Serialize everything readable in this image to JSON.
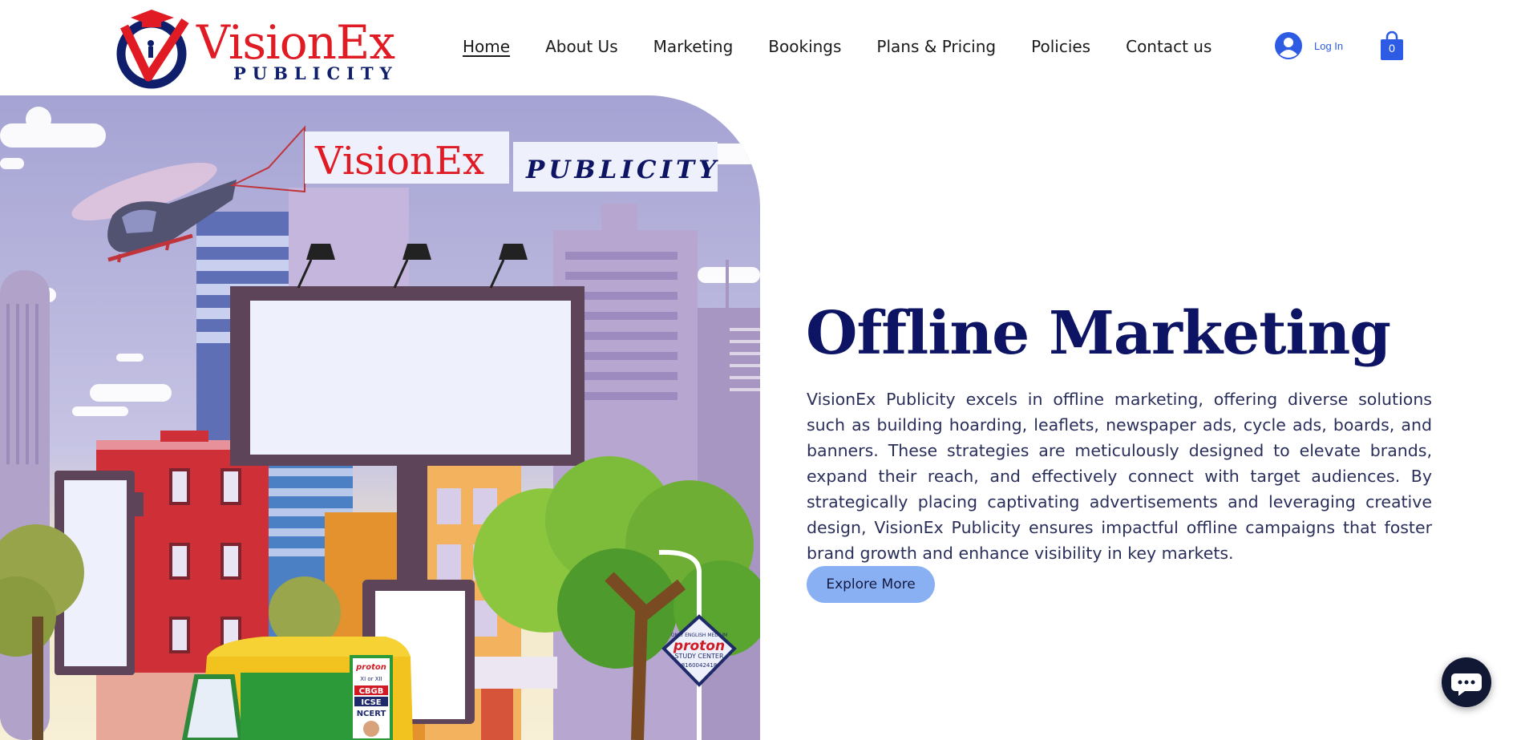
{
  "logo": {
    "word": "VisionEx",
    "sub": "PUBLICITY"
  },
  "nav": {
    "items": [
      {
        "label": "Home",
        "active": true
      },
      {
        "label": "About Us"
      },
      {
        "label": "Marketing"
      },
      {
        "label": "Bookings"
      },
      {
        "label": "Plans & Pricing"
      },
      {
        "label": "Policies"
      },
      {
        "label": "Contact us"
      }
    ]
  },
  "account": {
    "login_label": "Log In",
    "cart_count": "0"
  },
  "hero": {
    "banner_word": "VisionEx",
    "banner_sub": "PUBLICITY",
    "poster_lines": [
      "ONLY ENGLISH MEDIUM",
      "proton",
      "STUDY CENTER",
      "8160042418"
    ],
    "auto_poster_lines": [
      "proton",
      "XI or XII",
      "CBGB",
      "ICSE",
      "NCERT"
    ],
    "title": "Offline Marketing",
    "body": "VisionEx Publicity excels in offline marketing, offering diverse solutions such as building hoarding, leaflets, newspaper ads, cycle ads, boards, and banners. These strategies are meticulously designed to elevate brands, expand their reach, and effectively connect with target audiences. By strategically placing captivating advertisements and leveraging creative design, VisionEx Publicity ensures impactful offline campaigns that foster brand growth and enhance visibility in key markets.",
    "cta_label": "Explore More"
  },
  "colors": {
    "brand_red": "#e01b24",
    "brand_navy": "#0d1463",
    "button_blue": "#8ab0f4",
    "link_blue": "#2d5be3"
  },
  "icons": {
    "login": "user-avatar-icon",
    "cart": "shopping-bag-icon",
    "chat": "chat-bubble-icon"
  }
}
